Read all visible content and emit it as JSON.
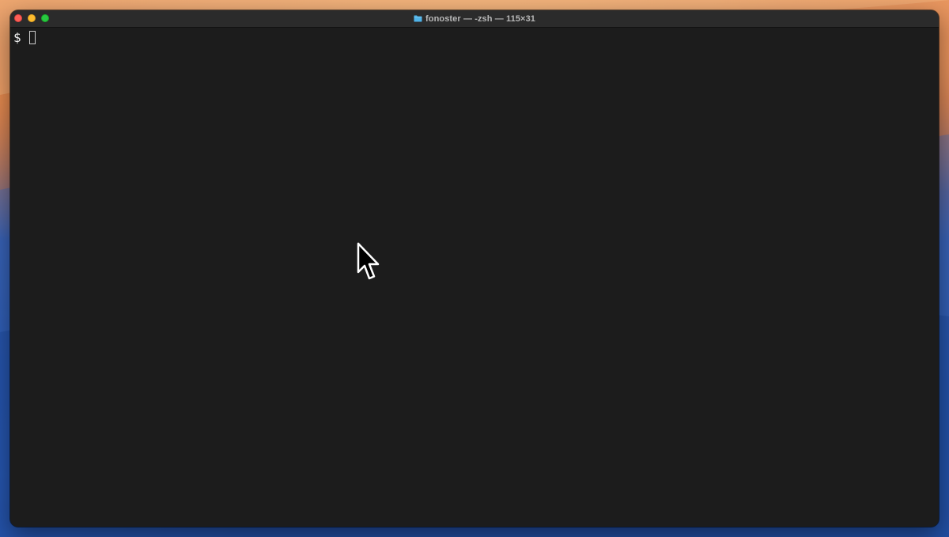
{
  "window": {
    "title": "fonoster — -zsh — 115×31",
    "folder_icon": "folder-icon",
    "controls": [
      "close-button",
      "minimize-button",
      "maximize-button"
    ]
  },
  "terminal": {
    "prompt": "$",
    "input_value": ""
  },
  "colors": {
    "terminal_bg": "#1c1c1c",
    "titlebar_bg": "#2b2b2b",
    "title_text": "#b8b8b8",
    "close": "#fe5f57",
    "minimize": "#febc2e",
    "maximize": "#28c840",
    "folder": "#4fb3e8"
  }
}
